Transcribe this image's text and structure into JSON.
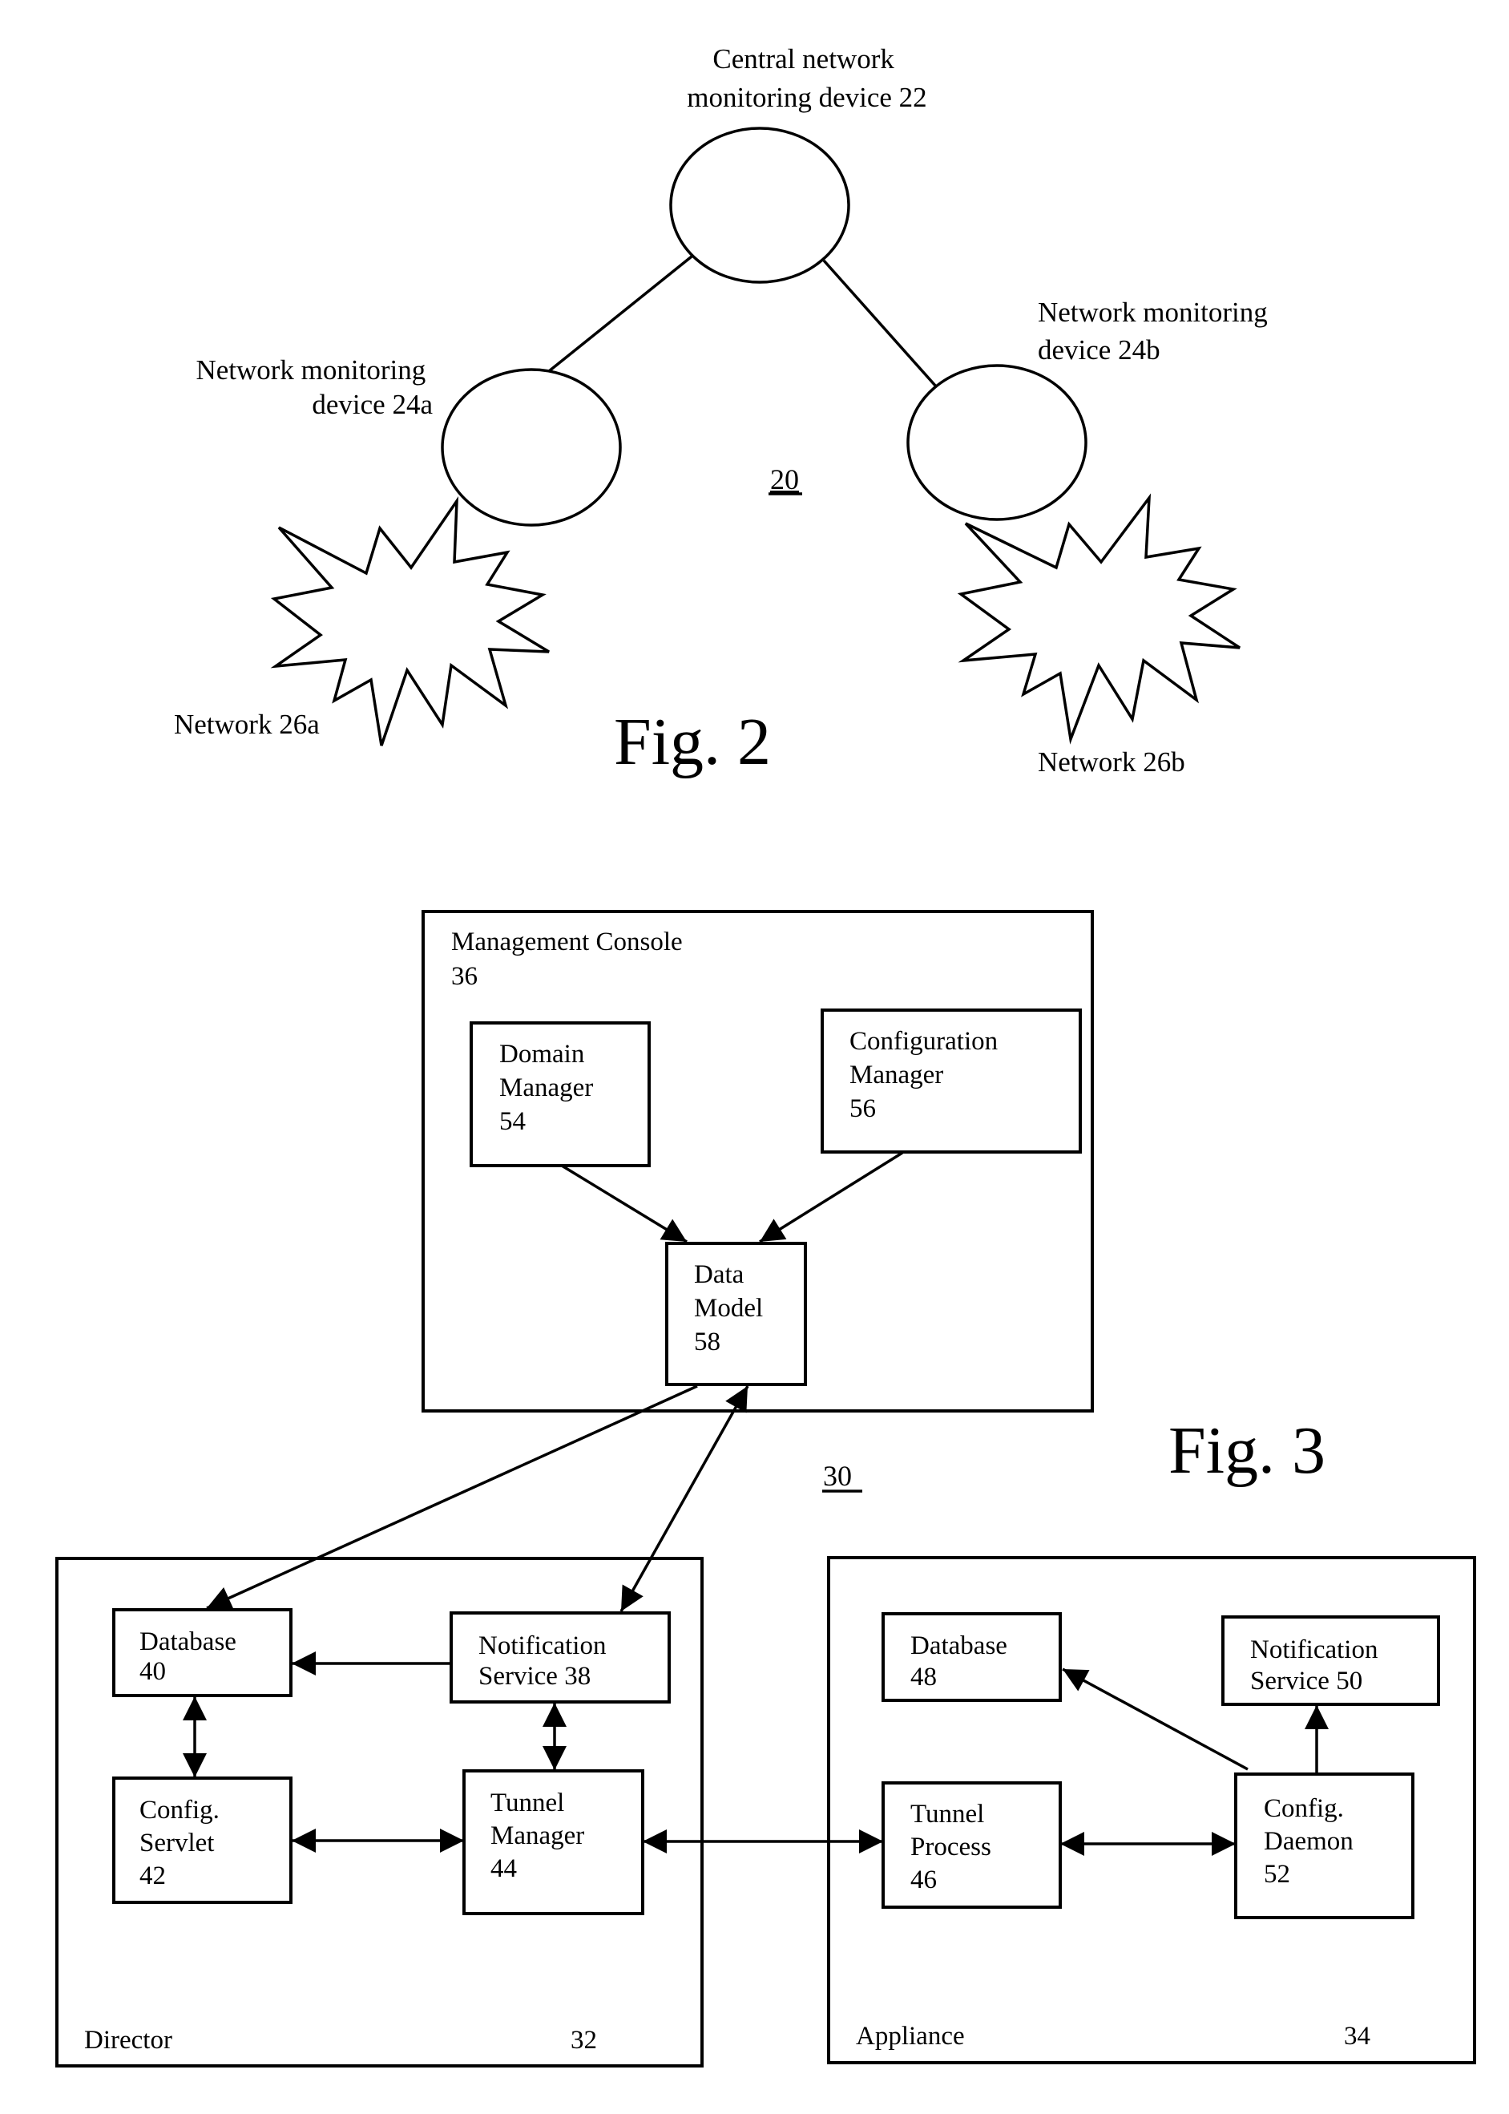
{
  "fig2": {
    "caption": "Fig. 2",
    "reference": "20",
    "central_device": {
      "line1": "Central network",
      "line2": "monitoring device 22"
    },
    "device_a": {
      "line1": "Network monitoring",
      "line2": "device 24a"
    },
    "device_b": {
      "line1": "Network monitoring",
      "line2": "device 24b"
    },
    "network_a": {
      "label": "Network 26a"
    },
    "network_b": {
      "label": "Network 26b"
    }
  },
  "fig3": {
    "caption": "Fig. 3",
    "reference": "30",
    "management_console": {
      "line1": "Management Console",
      "line2": "36",
      "domain_manager": {
        "line1": "Domain",
        "line2": "Manager",
        "line3": "54"
      },
      "configuration_manager": {
        "line1": "Configuration",
        "line2": "Manager",
        "line3": "56"
      },
      "data_model": {
        "line1": "Data",
        "line2": "Model",
        "line3": "58"
      }
    },
    "director": {
      "label": "Director",
      "number": "32",
      "database": {
        "line1": "Database",
        "line2": "40"
      },
      "notification_service": {
        "line1": "Notification",
        "line2": "Service 38"
      },
      "config_servlet": {
        "line1": "Config.",
        "line2": "Servlet",
        "line3": "42"
      },
      "tunnel_manager": {
        "line1": "Tunnel",
        "line2": "Manager",
        "line3": "44"
      }
    },
    "appliance": {
      "label": "Appliance",
      "number": "34",
      "database": {
        "line1": "Database",
        "line2": "48"
      },
      "notification_service": {
        "line1": "Notification",
        "line2": "Service 50"
      },
      "tunnel_process": {
        "line1": "Tunnel",
        "line2": "Process",
        "line3": "46"
      },
      "config_daemon": {
        "line1": "Config.",
        "line2": "Daemon",
        "line3": "52"
      }
    }
  }
}
